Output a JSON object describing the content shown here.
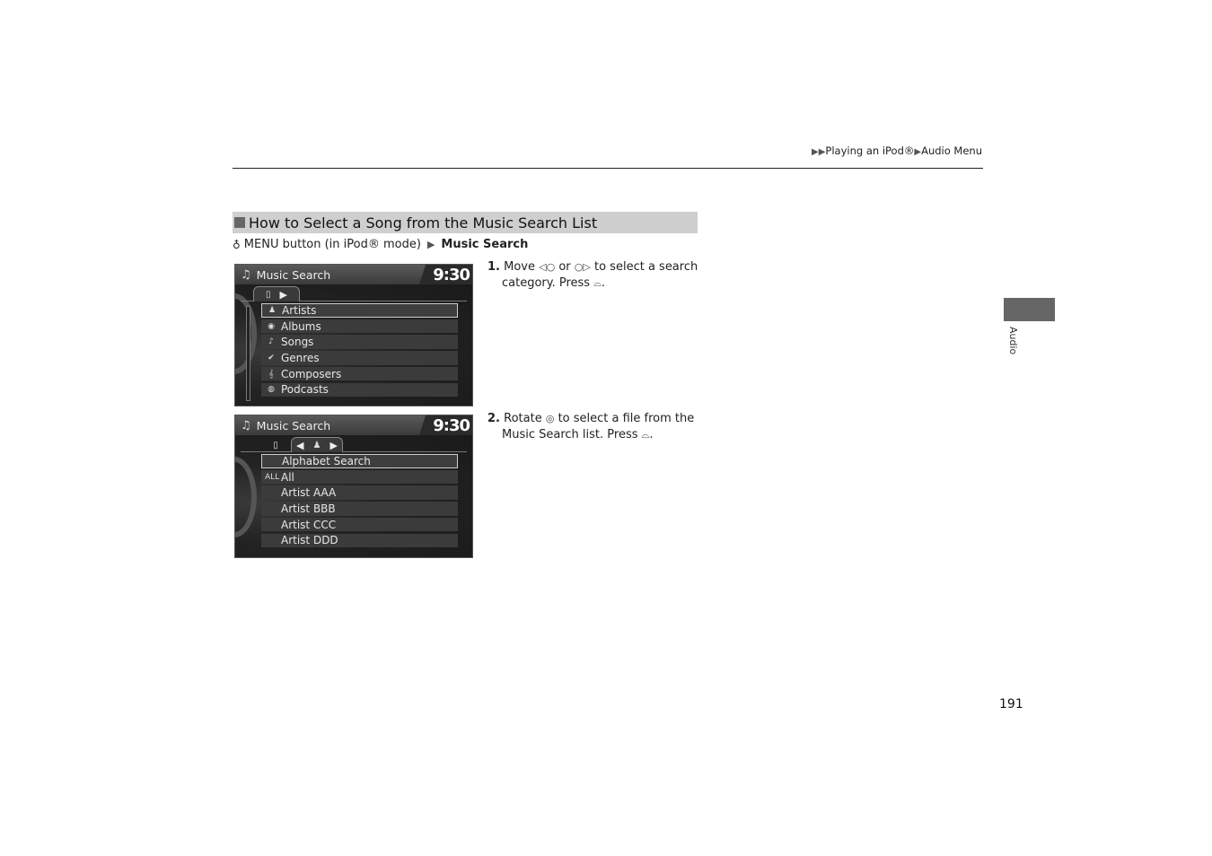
{
  "header": {
    "breadcrumb": [
      "Playing an iPod®",
      "Audio Menu"
    ],
    "breadcrumb_prefix_icon": "double-triangle-right-icon"
  },
  "section": {
    "title": "How to Select a Song from the Music Search List",
    "path": {
      "icon": "voice-command-icon",
      "text": "MENU button (in iPod® mode)",
      "target": "Music Search"
    }
  },
  "screen1": {
    "title": "Music Search",
    "clock": "9:30",
    "items": [
      {
        "icon": "artist-icon",
        "label": "Artists",
        "selected": true
      },
      {
        "icon": "album-icon",
        "label": "Albums"
      },
      {
        "icon": "song-icon",
        "label": "Songs"
      },
      {
        "icon": "genre-icon",
        "label": "Genres"
      },
      {
        "icon": "composer-icon",
        "label": "Composers"
      },
      {
        "icon": "podcast-icon",
        "label": "Podcasts"
      }
    ]
  },
  "screen2": {
    "title": "Music Search",
    "clock": "9:30",
    "items": [
      {
        "icon": "",
        "label": "Alphabet Search",
        "selected": true
      },
      {
        "icon": "all-icon",
        "label": "All"
      },
      {
        "icon": "",
        "label": "Artist AAA"
      },
      {
        "icon": "",
        "label": "Artist BBB"
      },
      {
        "icon": "",
        "label": "Artist CCC"
      },
      {
        "icon": "",
        "label": "Artist DDD"
      }
    ]
  },
  "steps": [
    {
      "num": "1.",
      "line1": "Move",
      "g1": "◁○",
      "mid": "or",
      "g2": "○▷",
      "line1_end": "to select a search",
      "line2": "category. Press",
      "g3": "⌓",
      "end": "."
    },
    {
      "num": "2.",
      "line1": "Rotate",
      "g1": "◎",
      "line1_end": "to select a file from the",
      "line2": "Music Search list. Press",
      "g3": "⌓",
      "end": "."
    }
  ],
  "sidebar": {
    "label": "Audio"
  },
  "footer": {
    "page_number": "191"
  }
}
